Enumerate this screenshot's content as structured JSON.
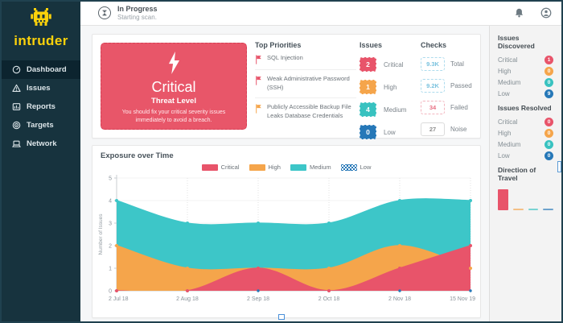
{
  "app": {
    "title": "intruder",
    "brand_color": "#fcd20b",
    "sidebar_bg": "#17333e"
  },
  "topbar": {
    "status_title": "In Progress",
    "status_subtitle": "Starting scan.",
    "icons": [
      "hourglass-icon",
      "bell-icon",
      "user-icon"
    ]
  },
  "sidebar": {
    "items": [
      {
        "label": "Dashboard",
        "icon": "gauge-icon",
        "active": true
      },
      {
        "label": "Issues",
        "icon": "warning-triangle-icon",
        "active": false
      },
      {
        "label": "Reports",
        "icon": "report-icon",
        "active": false
      },
      {
        "label": "Targets",
        "icon": "target-icon",
        "active": false
      },
      {
        "label": "Network",
        "icon": "laptop-icon",
        "active": false
      }
    ]
  },
  "severity_colors": {
    "critical": "#e8546a",
    "high": "#f5a54b",
    "medium": "#38c2c0",
    "low": "#2678b8"
  },
  "threat_card": {
    "level": "Critical",
    "sublabel": "Threat Level",
    "description": "You should fix your critical severity issues immediately to avoid a breach.",
    "bg": "#e85669",
    "icon": "lightning-bolt-icon"
  },
  "top_priorities": {
    "title": "Top Priorities",
    "items": [
      {
        "label": "SQL Injection",
        "flag": "critical"
      },
      {
        "label": "Weak Administrative Password (SSH)",
        "flag": "critical"
      },
      {
        "label": "Publicly Accessible Backup File Leaks Database Credentials",
        "flag": "high"
      }
    ]
  },
  "issues_summary": {
    "title": "Issues",
    "rows": [
      {
        "count": "2",
        "label": "Critical",
        "severity": "critical"
      },
      {
        "count": "1",
        "label": "High",
        "severity": "high"
      },
      {
        "count": "4",
        "label": "Medium",
        "severity": "medium"
      },
      {
        "count": "0",
        "label": "Low",
        "severity": "low"
      }
    ]
  },
  "checks_summary": {
    "title": "Checks",
    "rows": [
      {
        "value": "9.3K",
        "label": "Total",
        "style": "info",
        "color": "#7ac2de"
      },
      {
        "value": "9.2K",
        "label": "Passed",
        "style": "info",
        "color": "#7ac2de"
      },
      {
        "value": "34",
        "label": "Failed",
        "style": "danger",
        "color": "#e87084"
      },
      {
        "value": "27",
        "label": "Noise",
        "style": "muted",
        "color": "#8e8e8e"
      }
    ]
  },
  "right_panel": {
    "discovered": {
      "title": "Issues Discovered",
      "rows": [
        {
          "label": "Critical",
          "count": "1",
          "severity": "critical"
        },
        {
          "label": "High",
          "count": "0",
          "severity": "high"
        },
        {
          "label": "Medium",
          "count": "0",
          "severity": "medium"
        },
        {
          "label": "Low",
          "count": "9",
          "severity": "low"
        }
      ]
    },
    "resolved": {
      "title": "Issues Resolved",
      "rows": [
        {
          "label": "Critical",
          "count": "0",
          "severity": "critical"
        },
        {
          "label": "High",
          "count": "0",
          "severity": "high"
        },
        {
          "label": "Medium",
          "count": "0",
          "severity": "medium"
        },
        {
          "label": "Low",
          "count": "0",
          "severity": "low"
        }
      ]
    },
    "direction": {
      "title": "Direction of Travel",
      "bars": [
        {
          "label": "Critical",
          "value": 2,
          "severity": "critical"
        },
        {
          "label": "High",
          "value": 0,
          "severity": "high"
        },
        {
          "label": "Medium",
          "value": 0,
          "severity": "medium"
        },
        {
          "label": "Low",
          "value": 0,
          "severity": "low"
        }
      ]
    }
  },
  "chart_data": {
    "type": "area",
    "stacked": false,
    "title": "Exposure over Time",
    "x": [
      "2 Jul 18",
      "2 Aug 18",
      "2 Sep 18",
      "2 Oct 18",
      "2 Nov 18",
      "15 Nov 19"
    ],
    "ylabel": "Number of Issues",
    "ylim": [
      0,
      5
    ],
    "yticks": [
      0,
      1,
      2,
      3,
      4,
      5
    ],
    "grid": true,
    "legend_position": "top",
    "series": [
      {
        "name": "Critical",
        "color": "#e8546a",
        "values": [
          0,
          0,
          1,
          0,
          1,
          2
        ],
        "fill": true,
        "swatch": "solid"
      },
      {
        "name": "High",
        "color": "#f5a54b",
        "values": [
          2,
          1,
          1,
          1,
          2,
          1
        ],
        "fill": true,
        "swatch": "solid"
      },
      {
        "name": "Medium",
        "color": "#3dc6c8",
        "values": [
          4,
          3,
          3,
          3,
          4,
          4
        ],
        "fill": true,
        "swatch": "solid"
      },
      {
        "name": "Low",
        "color": "#2678b8",
        "values": [
          0,
          0,
          0,
          0,
          0,
          0
        ],
        "fill": false,
        "swatch": "checker"
      }
    ],
    "area_draw_order": [
      2,
      1,
      0
    ],
    "marker_draw_order": [
      3,
      2,
      1,
      0
    ]
  }
}
